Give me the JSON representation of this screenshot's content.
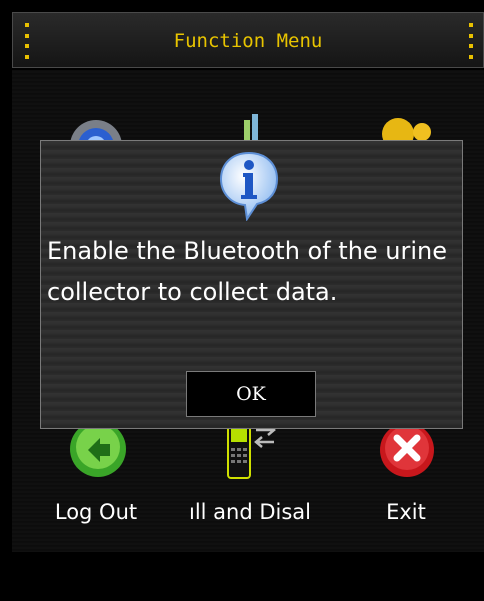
{
  "header": {
    "title": "Function Menu"
  },
  "menu": {
    "items": [
      {
        "label": "Log Out",
        "icon": "logout-icon"
      },
      {
        "label": "ıll and Disal",
        "icon": "phone-transfer-icon"
      },
      {
        "label": "Exit",
        "icon": "exit-icon"
      }
    ],
    "top_icons": [
      "settings-gear-icon",
      "chart-icon",
      "users-icon"
    ]
  },
  "dialog": {
    "icon": "info-icon",
    "message": "Enable the Bluetooth of the urine collector to collect data.",
    "ok_label": "OK"
  },
  "colors": {
    "title": "#e8c400",
    "background": "#000000",
    "dialog_border": "#7a7a7a"
  }
}
